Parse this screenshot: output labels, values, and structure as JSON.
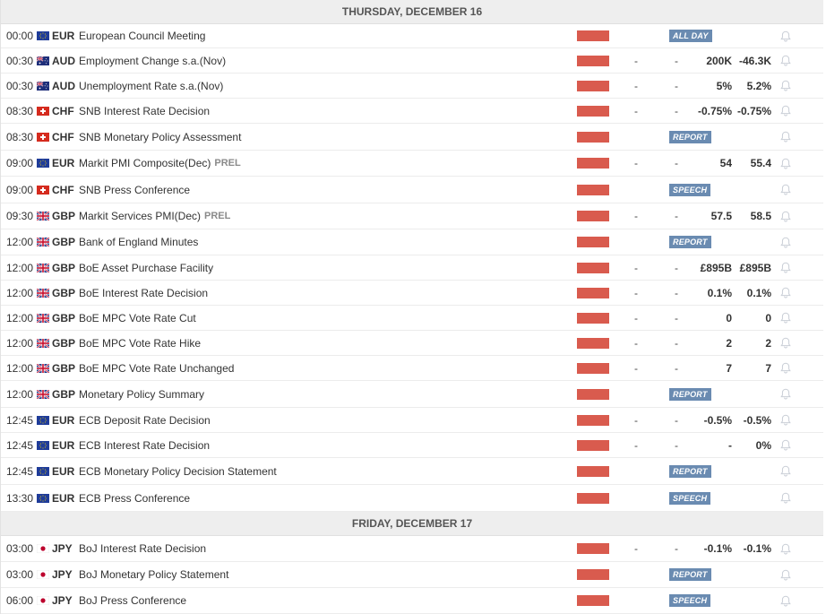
{
  "days": [
    {
      "label": "THURSDAY, DECEMBER 16",
      "events": [
        {
          "time": "00:00",
          "flag": "eu-flag",
          "currency": "EUR",
          "name": "European Council Meeting",
          "badge": "ALL DAY",
          "h": 26
        },
        {
          "time": "00:30",
          "flag": "au-flag",
          "currency": "AUD",
          "name": "Employment Change s.a.(Nov)",
          "actual": "-",
          "forecast": "-",
          "previous": "200K",
          "consensus": "-46.3K",
          "h": 27
        },
        {
          "time": "00:30",
          "flag": "au-flag",
          "currency": "AUD",
          "name": "Unemployment Rate s.a.(Nov)",
          "actual": "-",
          "forecast": "-",
          "previous": "5%",
          "consensus": "5.2%",
          "h": 27
        },
        {
          "time": "08:30",
          "flag": "ch-flag",
          "currency": "CHF",
          "name": "SNB Interest Rate Decision",
          "actual": "-",
          "forecast": "-",
          "previous": "-0.75%",
          "consensus": "-0.75%",
          "h": 27
        },
        {
          "time": "08:30",
          "flag": "ch-flag",
          "currency": "CHF",
          "name": "SNB Monetary Policy Assessment",
          "badge": "REPORT",
          "h": 29
        },
        {
          "time": "09:00",
          "flag": "eu-flag",
          "currency": "EUR",
          "name": "Markit PMI Composite(Dec)",
          "tag": "PREL",
          "actual": "-",
          "forecast": "-",
          "previous": "54",
          "consensus": "55.4",
          "h": 28
        },
        {
          "time": "09:00",
          "flag": "ch-flag",
          "currency": "CHF",
          "name": "SNB Press Conference",
          "badge": "SPEECH",
          "h": 29
        },
        {
          "time": "09:30",
          "flag": "gb-flag",
          "currency": "GBP",
          "name": "Markit Services PMI(Dec)",
          "tag": "PREL",
          "actual": "-",
          "forecast": "-",
          "previous": "57.5",
          "consensus": "58.5",
          "h": 28
        },
        {
          "time": "12:00",
          "flag": "gb-flag",
          "currency": "GBP",
          "name": "Bank of England Minutes",
          "badge": "REPORT",
          "h": 28
        },
        {
          "time": "12:00",
          "flag": "gb-flag",
          "currency": "GBP",
          "name": "BoE Asset Purchase Facility",
          "actual": "-",
          "forecast": "-",
          "previous": "£895B",
          "consensus": "£895B",
          "h": 27
        },
        {
          "time": "12:00",
          "flag": "gb-flag",
          "currency": "GBP",
          "name": "BoE Interest Rate Decision",
          "actual": "-",
          "forecast": "-",
          "previous": "0.1%",
          "consensus": "0.1%",
          "h": 27
        },
        {
          "time": "12:00",
          "flag": "gb-flag",
          "currency": "GBP",
          "name": "BoE MPC Vote Rate Cut",
          "actual": "-",
          "forecast": "-",
          "previous": "0",
          "consensus": "0",
          "h": 27
        },
        {
          "time": "12:00",
          "flag": "gb-flag",
          "currency": "GBP",
          "name": "BoE MPC Vote Rate Hike",
          "actual": "-",
          "forecast": "-",
          "previous": "2",
          "consensus": "2",
          "h": 27
        },
        {
          "time": "12:00",
          "flag": "gb-flag",
          "currency": "GBP",
          "name": "BoE MPC Vote Rate Unchanged",
          "actual": "-",
          "forecast": "-",
          "previous": "7",
          "consensus": "7",
          "h": 27
        },
        {
          "time": "12:00",
          "flag": "gb-flag",
          "currency": "GBP",
          "name": "Monetary Policy Summary",
          "badge": "REPORT",
          "h": 29
        },
        {
          "time": "12:45",
          "flag": "eu-flag",
          "currency": "EUR",
          "name": "ECB Deposit Rate Decision",
          "actual": "-",
          "forecast": "-",
          "previous": "-0.5%",
          "consensus": "-0.5%",
          "h": 27
        },
        {
          "time": "12:45",
          "flag": "eu-flag",
          "currency": "EUR",
          "name": "ECB Interest Rate Decision",
          "actual": "-",
          "forecast": "-",
          "previous": "-",
          "consensus": "0%",
          "h": 27
        },
        {
          "time": "12:45",
          "flag": "eu-flag",
          "currency": "EUR",
          "name": "ECB Monetary Policy Decision Statement",
          "badge": "REPORT",
          "h": 29
        },
        {
          "time": "13:30",
          "flag": "eu-flag",
          "currency": "EUR",
          "name": "ECB Press Conference",
          "badge": "SPEECH",
          "h": 29
        }
      ]
    },
    {
      "label": "FRIDAY, DECEMBER 17",
      "events": [
        {
          "time": "03:00",
          "flag": "jp-flag",
          "currency": "JPY",
          "name": "BoJ Interest Rate Decision",
          "actual": "-",
          "forecast": "-",
          "previous": "-0.1%",
          "consensus": "-0.1%",
          "h": 28
        },
        {
          "time": "03:00",
          "flag": "jp-flag",
          "currency": "JPY",
          "name": "BoJ Monetary Policy Statement",
          "badge": "REPORT",
          "h": 28
        },
        {
          "time": "06:00",
          "flag": "jp-flag",
          "currency": "JPY",
          "name": "BoJ Press Conference",
          "badge": "SPEECH",
          "h": 28
        }
      ]
    }
  ],
  "colors": {
    "impact": "#d95b4e",
    "badge": "#6a8bb1",
    "day_header_bg": "#eeeeee"
  },
  "icons": {
    "alert": "bell-icon",
    "importance": "impact-bar"
  }
}
